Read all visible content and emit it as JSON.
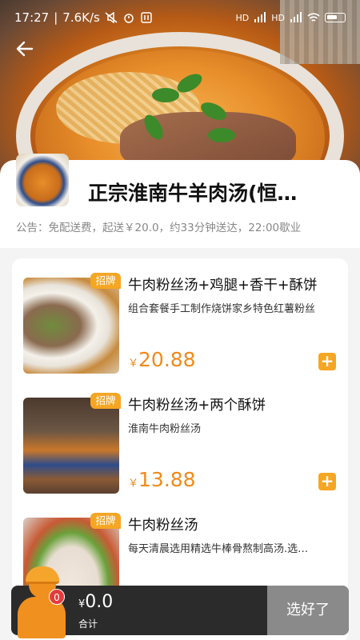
{
  "status_bar": {
    "time": "17:27",
    "speed": "7.6K/s",
    "signal_label": "HD",
    "battery_icon": "battery-icon"
  },
  "nav": {
    "back_icon": "arrow-left-icon"
  },
  "store": {
    "name": "正宗淮南牛羊肉汤(恒…",
    "notice": "公告：免配送费，起送￥20.0，约33分钟送达，22:00歇业"
  },
  "menu": {
    "items": [
      {
        "badge": "招牌",
        "title": "牛肉粉丝汤+鸡腿+香干+酥饼",
        "desc": "组合套餐手工制作烧饼家乡特色红薯粉丝",
        "currency": "￥",
        "price": "20.88",
        "add_label": "+"
      },
      {
        "badge": "招牌",
        "title": "牛肉粉丝汤+两个酥饼",
        "desc": "淮南牛肉粉丝汤",
        "currency": "￥",
        "price": "13.88",
        "add_label": "+"
      },
      {
        "badge": "招牌",
        "title": "牛肉粉丝汤",
        "desc": "每天清晨选用精选牛棒骨熬制高汤.选…",
        "currency": "￥",
        "price": "",
        "add_label": "+"
      }
    ]
  },
  "cart": {
    "count": "0",
    "currency": "¥",
    "total": "0.0",
    "total_label": "合计",
    "checkout_label": "选好了"
  },
  "colors": {
    "accent": "#f5a623",
    "price": "#f08a1c",
    "cart_bar": "#2b2b2b",
    "checkout_disabled": "#8a8a8a",
    "badge_count": "#e23b3b"
  }
}
